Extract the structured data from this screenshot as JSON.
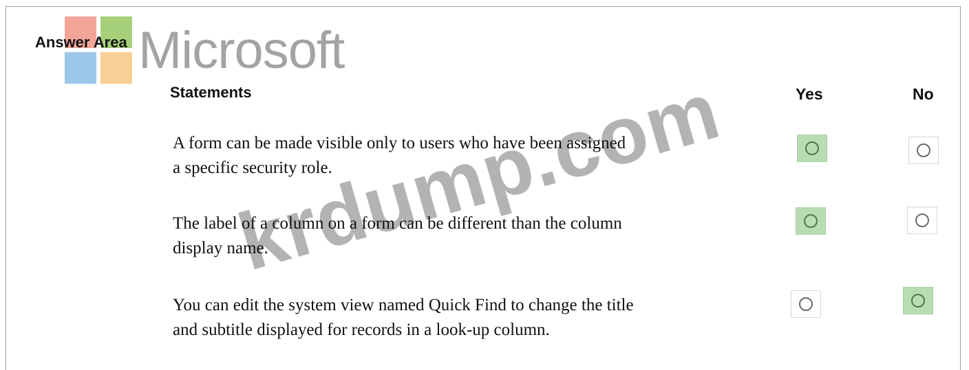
{
  "title": "Answer Area",
  "watermark_brand": "Microsoft",
  "watermark_site": "krdump.com",
  "headers": {
    "statements": "Statements",
    "yes": "Yes",
    "no": "No"
  },
  "statements": [
    {
      "line1": "A form can be made visible only to users who have been assigned",
      "line2": "a specific security role.",
      "selected": "yes"
    },
    {
      "line1": "The label of a column on a form can be different than the column",
      "line2": "display name.",
      "selected": "yes"
    },
    {
      "line1": "You can edit the system view named Quick Find to change the title",
      "line2": "and subtitle displayed for records in a look-up column.",
      "selected": "no"
    }
  ],
  "colors": {
    "selected_fill": "#b9dcb4",
    "logo_red": "#f4a59a",
    "logo_green": "#a6cf7a",
    "logo_blue": "#9cc6ea",
    "logo_yellow": "#f8cf95"
  }
}
